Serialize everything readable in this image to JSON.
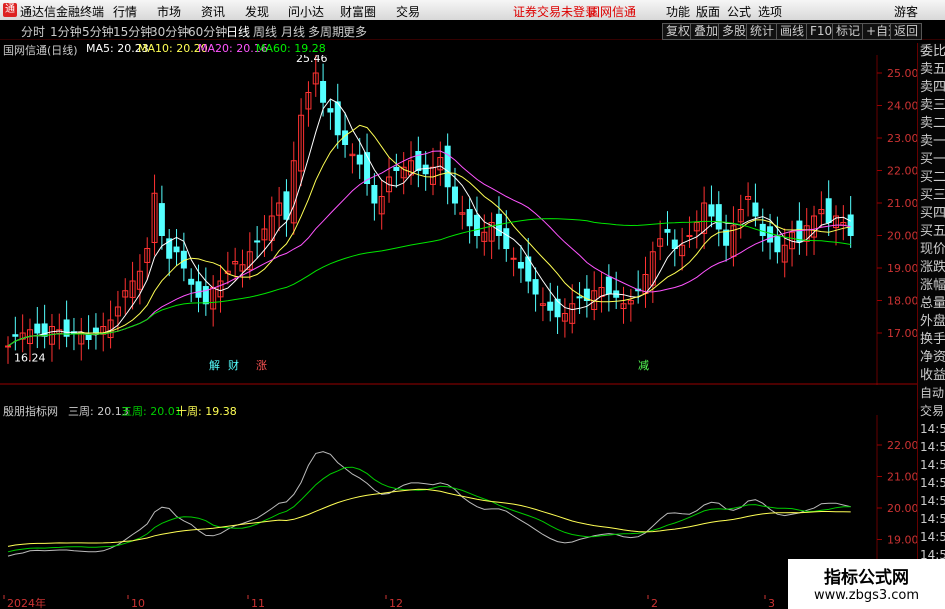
{
  "menubar": {
    "app_title": "通达信金融终端",
    "menus": [
      "行情",
      "市场",
      "资讯",
      "发现",
      "问小达",
      "财富圈",
      "交易"
    ],
    "status": "证券交易未登录",
    "stock": "国网信通",
    "right_menus": [
      "功能",
      "版面",
      "公式",
      "选项"
    ],
    "user": "游客"
  },
  "periodbar": {
    "periods": [
      "分时",
      "1分钟",
      "5分钟",
      "15分钟",
      "30分钟",
      "60分钟",
      "日线",
      "周线",
      "月线",
      "多周期",
      "更多"
    ],
    "active_index": 6,
    "tools": [
      "复权",
      "叠加",
      "多股",
      "统计",
      "画线",
      "F10",
      "标记",
      "+自选",
      "返回"
    ]
  },
  "main_chart": {
    "title": "国网信通(日线)",
    "ma5": "MA5: 20.23",
    "ma10": "MA10: 20.20",
    "ma20": "MA20: 20.16",
    "ma60": "MA60: 19.28",
    "max_label": "25.46",
    "min_label": "16.24",
    "ticks": [
      "25.00",
      "24.00",
      "23.00",
      "22.00",
      "21.00",
      "20.00",
      "19.00",
      "18.00",
      "17.00"
    ],
    "markers": [
      "解",
      "财",
      "涨",
      "减"
    ]
  },
  "indicator": {
    "title": "殷朋指标网",
    "w3": "三周: 20.13",
    "w5": "五周: 20.01",
    "w10": "十周: 19.38",
    "ticks": [
      "22.00",
      "21.00",
      "20.00",
      "19.00",
      "18.00"
    ]
  },
  "xaxis": [
    "2024年",
    "10",
    "11",
    "12",
    "2",
    "3"
  ],
  "side_panel": [
    "委比",
    "卖五",
    "卖四",
    "卖三",
    "卖二",
    "卖一",
    "买一",
    "买二",
    "买三",
    "买四",
    "买五",
    "现价",
    "涨跌",
    "涨幅",
    "总量",
    "外盘",
    "换手",
    "净资",
    "收益"
  ],
  "side_panel2": [
    "自动",
    "交易",
    "14:56",
    "14:56",
    "14:56",
    "14:56",
    "14:56",
    "14:56",
    "14:56",
    "14:56",
    "14:56"
  ],
  "watermark": {
    "line1": "指标公式网",
    "line2": "www.zbgs3.com"
  },
  "colors": {
    "up": "#ff3232",
    "down": "#54ffff",
    "ma5": "#ffffff",
    "ma10": "#ffff54",
    "ma20": "#ff54ff",
    "ma60": "#00e600"
  }
}
